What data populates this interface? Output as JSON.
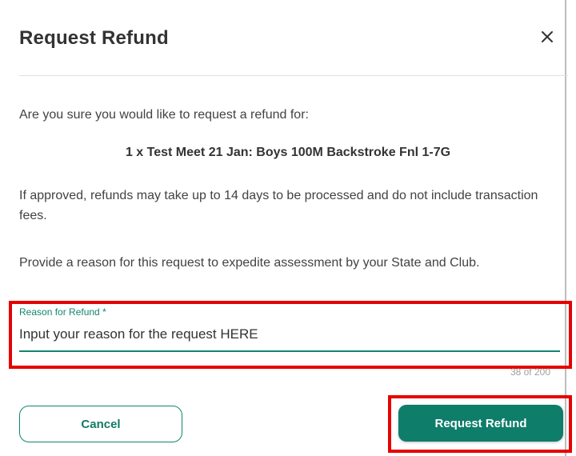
{
  "dialog": {
    "title": "Request Refund",
    "close_icon": "close-icon",
    "confirm_text": "Are you sure you would like to request a refund for:",
    "item_text": "1 x Test Meet 21 Jan: Boys 100M Backstroke Fnl 1-7G",
    "approval_text": "If approved, refunds may take up to 14 days to be processed and do not include transaction fees.",
    "reason_prompt": "Provide a reason for this request to expedite assessment by your State and Club."
  },
  "reason_field": {
    "label": "Reason for Refund *",
    "value": "Input your reason for the request HERE",
    "counter": "38 of 200"
  },
  "buttons": {
    "cancel_label": "Cancel",
    "submit_label": "Request Refund"
  },
  "colors": {
    "accent": "#128570",
    "primary_button": "#0e7d69",
    "highlight": "#e60000"
  }
}
